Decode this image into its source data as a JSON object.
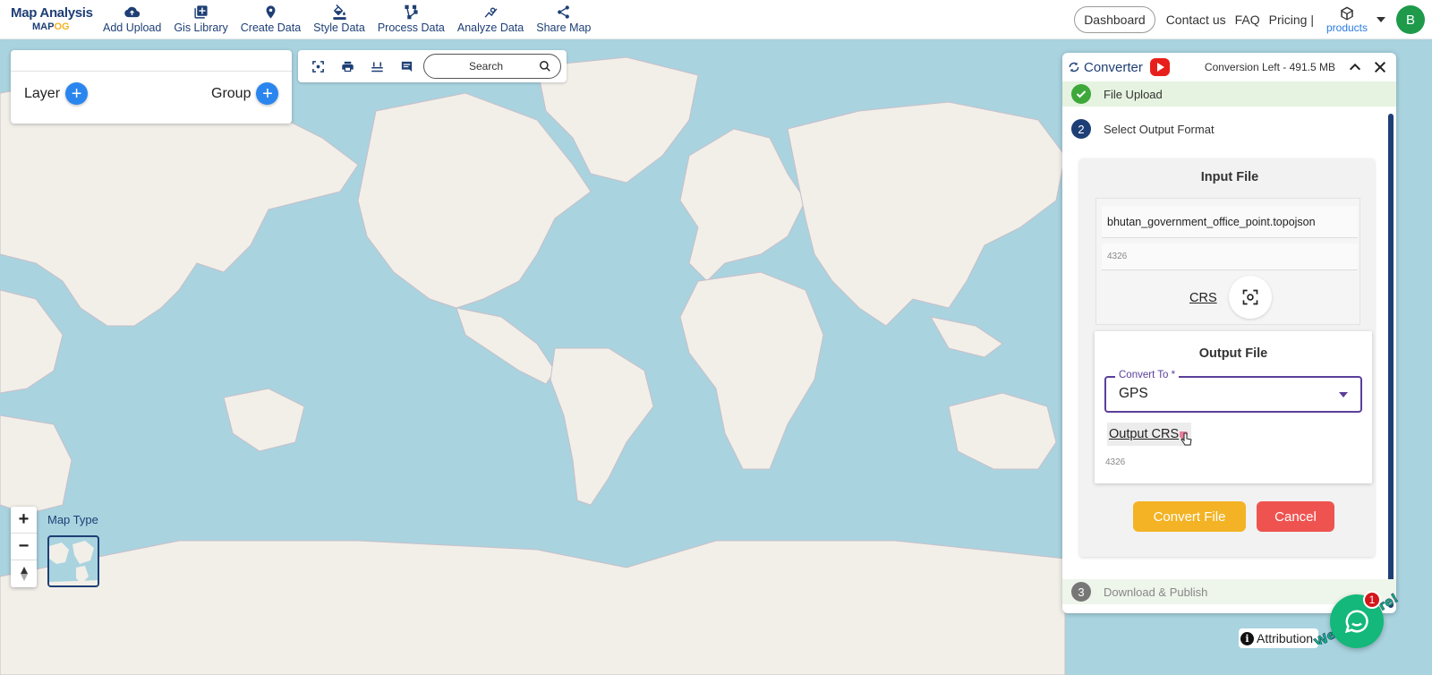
{
  "app": {
    "logo_line1": "Map Analysis",
    "logo_line2_prefix": "MAP",
    "logo_line2_accent": "OG"
  },
  "nav": {
    "items": [
      {
        "label": "Add Upload",
        "icon": "cloud-upload-icon"
      },
      {
        "label": "Gis Library",
        "icon": "library-add-icon"
      },
      {
        "label": "Create Data",
        "icon": "location-pin-icon"
      },
      {
        "label": "Style Data",
        "icon": "paint-bucket-icon"
      },
      {
        "label": "Process Data",
        "icon": "polyline-icon"
      },
      {
        "label": "Analyze Data",
        "icon": "analytics-icon"
      },
      {
        "label": "Share Map",
        "icon": "share-icon"
      }
    ],
    "dashboard": "Dashboard",
    "contact": "Contact us",
    "faq": "FAQ",
    "pricing": "Pricing |",
    "products": "products",
    "avatar_initial": "B"
  },
  "layer_panel": {
    "layer_label": "Layer",
    "group_label": "Group"
  },
  "toolbar": {
    "search_placeholder": "Search"
  },
  "map": {
    "map_type_label": "Map Type",
    "attribution": "Attribution",
    "colors": {
      "water": "#a9d3df",
      "land": "#f2efe9",
      "border": "#c9bfc9"
    }
  },
  "converter": {
    "title": "Converter",
    "conversion_left": "Conversion Left - 491.5 MB",
    "steps": [
      {
        "num": "1",
        "label": "File Upload",
        "state": "done"
      },
      {
        "num": "2",
        "label": "Select Output Format",
        "state": "active"
      },
      {
        "num": "3",
        "label": "Download & Publish",
        "state": "pending"
      }
    ],
    "input_file": {
      "title": "Input File",
      "filename": "bhutan_government_office_point.topojson",
      "crs_value": "4326",
      "crs_label": "CRS"
    },
    "output_file": {
      "title": "Output File",
      "convert_to_label": "Convert To *",
      "convert_to_value": "GPS",
      "output_crs_label": "Output CRS",
      "output_crs_value": "4326"
    },
    "convert_button": "Convert File",
    "cancel_button": "Cancel",
    "colors": {
      "accent": "#1e3f75",
      "convert": "#f4b324",
      "cancel": "#ef5350",
      "select_border": "#5b3f9a"
    }
  },
  "chat": {
    "badge": "1",
    "we_are_here": "We Are Here!"
  }
}
